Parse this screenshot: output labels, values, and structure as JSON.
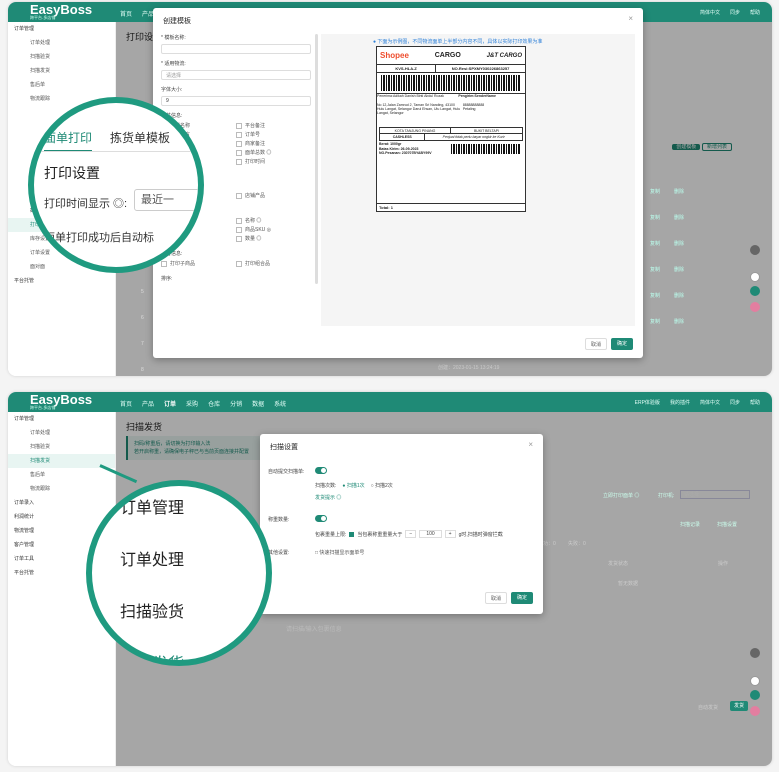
{
  "brand": {
    "name": "EasyBoss",
    "tagline": "跨平台-多店铺",
    "accent": "#1f8a76"
  },
  "p1": {
    "nav": [
      "首页",
      "产品"
    ],
    "topright": [
      "简体中文",
      "同步",
      "帮助"
    ],
    "sidebar": {
      "group": "订单管理",
      "items": [
        "订单处理",
        "扫描验货",
        "扫描发货",
        "售后单",
        "物流跟踪",
        "打印设置",
        "标签规则",
        "截单规则",
        "打印设置",
        "库存设置",
        "订单设置",
        "面对面"
      ],
      "bottom": "平台托管"
    },
    "page_title": "打印设",
    "modal": {
      "title": "创建模板",
      "name_label": "* 模板名称:",
      "platform_label": "* 适用物流:",
      "platform_placeholder": "请选择",
      "font_label": "字体大小:",
      "font_value": "9",
      "common_label": "公共信息:",
      "common_items": [
        "店铺名称",
        "平台备注",
        "买家留言",
        "订单号",
        "总数",
        "商家备注",
        "面单序号 ◎",
        "面单总数 ◎",
        "下单时间",
        "打印时间",
        "打印次数"
      ],
      "add_label": "加打信息:",
      "add_items": [
        "仓库商品",
        "店铺产品"
      ],
      "product_label": "商品信息:",
      "product_items": [
        "图片 ◎",
        "名称 ◎",
        "SKU规格",
        "商品SKU ◎",
        "仓位",
        "数量 ◎"
      ],
      "combo_label": "组合信息:",
      "combo_items": [
        "打印子商品",
        "打印组合品"
      ],
      "sort_label": "排序:",
      "hint": "下面为示例图，不同物流面单上半部分内容不同，具体以实际打印效果为准",
      "cancel": "取消",
      "confirm": "确定"
    },
    "label": {
      "shopee": "Shopee",
      "cargo": "CARGO",
      "jt": "J&T CARGO",
      "code": "KVS-HLA-Z",
      "resi": "NO.Resi:SPXMY030226863257",
      "penerima": "Penerima:Adikah Danish Binti Abdul Rozak",
      "pengirim": "Pengirim:SenderName",
      "addr": "No 12,Jalan Zamrud 2, Taman Sri Nanding, 43100 Hulu Langat, Selangor Darul Ehsan, Ulu Langat, Hulu Langat, Selangor",
      "phone": "88888888888",
      "city": "Petaling",
      "kota": "KOTA TANJUNG PINANG",
      "bukit": "BUKIT BELTAPI",
      "cashless": "CASHLESS",
      "note": "Penjual tidak perlu bayar ongkir ke Kurir",
      "berat": "Berat: 1000gr",
      "batas": "Batas Kirim: 26-09-2023",
      "pesanan": "NO.Pesanan: 230707BYABY99V",
      "total": "Total: 1"
    },
    "circle": {
      "tab1": "面单打印",
      "tab2": "拣货单模板",
      "heading": "打印设置",
      "time_label": "打印时间显示 ◎:",
      "time_value": "最近一",
      "auto_text": "面单打印成功后自动标"
    },
    "table": {
      "btn1": "创建模板",
      "btn2": "新增列表",
      "col": "操作",
      "row_nums": [
        "4",
        "5",
        "6",
        "7",
        "8"
      ],
      "actions": [
        "编辑",
        "复制",
        "删除"
      ],
      "footer": "创建：2023-01-15 13:24:19"
    }
  },
  "p2": {
    "nav": [
      "首页",
      "产品",
      "订单",
      "采购",
      "仓库",
      "分销",
      "数据",
      "系统"
    ],
    "topright": [
      "ERP体验版",
      "我的插件",
      "简体中文",
      "同步",
      "帮助"
    ],
    "sidebar": {
      "group": "订单管理",
      "items": [
        "订单处理",
        "扫描验货",
        "扫描发货",
        "售后单",
        "物流跟踪"
      ],
      "groups": [
        "订单录入",
        "利润统计",
        "物流管理",
        "客户管理",
        "订单工具",
        "平台托管"
      ]
    },
    "page_title": "扫描发货",
    "notice1": "扫码/称重后，请切换为打印输入法",
    "notice2": "若开启称重，请确保电子秤已与当前页面连接并配置",
    "modal": {
      "title": "扫描设置",
      "auto_label": "自动提交扫描单:",
      "scan_count": "扫描次数:",
      "opt1": "扫描1次",
      "opt2": "扫描2次",
      "link": "发货提示 ◎",
      "weigh_label": "称重数量:",
      "upper_label": "包裹重量上限:",
      "upper_text": "当包裹称重重量大于",
      "upper_value": "100",
      "upper_unit": "g时,扫描时弹窗拦截",
      "other_label": "其他设置:",
      "other_text": "快速扫描显示面单号",
      "cancel": "取消",
      "confirm": "确定"
    },
    "right": {
      "print_label": "立即打印面单 ◎",
      "printer": "打印机:",
      "printer_value": "请选择",
      "btn1": "扫描记录",
      "btn2": "扫描设置",
      "success": "成功：0",
      "fail": "失败：0",
      "col1": "发货状态",
      "col2": "操作",
      "empty": "暂无数据",
      "input_hint": "请扫描/输入包裹信息",
      "auto_ship": "自动发货",
      "ship": "发货"
    },
    "circle": {
      "items": [
        "订单管理",
        "订单处理",
        "扫描验货",
        "扫描发货"
      ]
    }
  }
}
